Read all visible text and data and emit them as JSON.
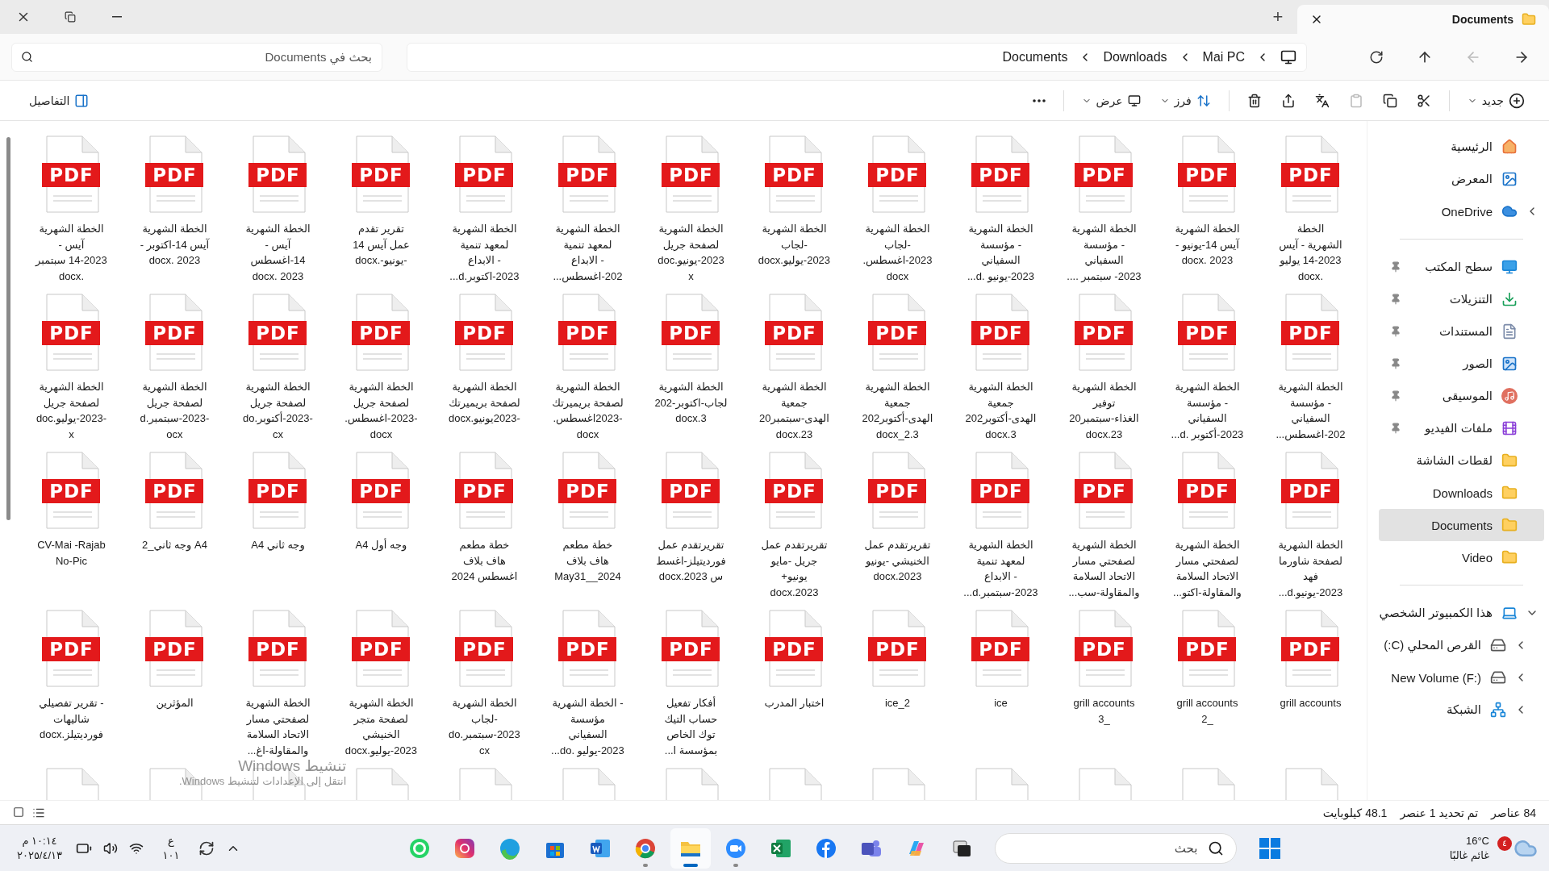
{
  "window": {
    "tab_title": "Documents",
    "new_tab": "+"
  },
  "search": {
    "placeholder": "بحث في Documents"
  },
  "breadcrumb": [
    "Mai PC",
    "Downloads",
    "Documents"
  ],
  "nav": [
    {
      "disabled": false
    },
    {
      "disabled": true
    },
    {
      "disabled": false
    },
    {
      "disabled": false
    }
  ],
  "toolbar": {
    "new_label": "جديد",
    "actions": [
      {
        "disabled": false
      },
      {
        "disabled": false
      },
      {
        "disabled": true
      },
      {
        "disabled": false
      },
      {
        "disabled": false
      },
      {
        "disabled": false
      }
    ],
    "sort_label": "فرز",
    "view_label": "عرض",
    "details_label": "التفاصيل"
  },
  "files": [
    {
      "label": "الخطة\nالشهرية - آيس\n14-2023 يوليو\n.docx",
      "badge": "PDF",
      "cut_off": false
    },
    {
      "label": "الخطة الشهرية\nآيس 14-يونيو -\n2023 .docx",
      "badge": "PDF",
      "cut_off": false
    },
    {
      "label": "الخطة الشهرية\n- مؤسسة\nالسفياني\n2023- سبتمبر ....",
      "badge": "PDF",
      "cut_off": false
    },
    {
      "label": "الخطة الشهرية\n- مؤسسة\nالسفياني\n2023-يونيو .d...",
      "badge": "PDF",
      "cut_off": false
    },
    {
      "label": "الخطة الشهرية\n-لجاب\n2023-اغسطس.\ndocx",
      "badge": "PDF",
      "cut_off": false
    },
    {
      "label": "الخطة الشهرية\n-لجاب\n2023-يوليو.docx",
      "badge": "PDF",
      "cut_off": false
    },
    {
      "label": "الخطة الشهرية\nلصفحة جريل\n2023-يونيو.doc\nx",
      "badge": "PDF",
      "cut_off": false
    },
    {
      "label": "الخطة الشهرية\nلمعهد تنمية\n- الابداع\n202-اغسطس...",
      "badge": "PDF",
      "cut_off": false
    },
    {
      "label": "الخطة الشهرية\nلمعهد تنمية\n- الابداع\n2023-اكتوبر.d...",
      "badge": "PDF",
      "cut_off": false
    },
    {
      "label": "تقرير تقدم\nعمل آيس 14\n-يونيو-.docx",
      "badge": "PDF",
      "cut_off": false
    },
    {
      "label": "الخطة الشهرية\nآيس -\n14-اغسطس\n2023 .docx",
      "badge": "PDF",
      "cut_off": false
    },
    {
      "label": "الخطة الشهرية\nآيس 14-اكتوبر -\n2023 .docx",
      "badge": "PDF",
      "cut_off": false
    },
    {
      "label": "الخطة الشهرية\nآيس -\n14-2023 سبتمبر\n.docx",
      "badge": "PDF",
      "cut_off": false
    },
    {
      "label": "الخطة الشهرية\n- مؤسسة\nالسفياني\n202-اغسطس...",
      "badge": "PDF",
      "cut_off": false
    },
    {
      "label": "الخطة الشهرية\n- مؤسسة\nالسفياني\n2023-أكتوبر .d...",
      "badge": "PDF",
      "cut_off": false
    },
    {
      "label": "الخطة الشهرية\nتوفير\nالغذاء-سبتمبر20\n23.docx",
      "badge": "PDF",
      "cut_off": false
    },
    {
      "label": "الخطة الشهرية\nجمعية\nالهدى-أكتوبر202\n3.docx",
      "badge": "PDF",
      "cut_off": false
    },
    {
      "label": "الخطة الشهرية\nجمعية\nالهدى-أكتوبر202\n3.docx_2",
      "badge": "PDF",
      "cut_off": false
    },
    {
      "label": "الخطة الشهرية\nجمعية\nالهدى-سبتمبر20\n23.docx",
      "badge": "PDF",
      "cut_off": false
    },
    {
      "label": "الخطة الشهرية\nلجاب-اكتوبر-202\n3.docx",
      "badge": "PDF",
      "cut_off": false
    },
    {
      "label": "الخطة الشهرية\nلصفحة بريميرتك\n-2023اغسطس.\ndocx",
      "badge": "PDF",
      "cut_off": false
    },
    {
      "label": "الخطة الشهرية\nلصفحة بريميرتك\n-2023يونيو.docx",
      "badge": "PDF",
      "cut_off": false
    },
    {
      "label": "الخطة الشهرية\nلصفحة جريل\n-2023-اغسطس.\ndocx",
      "badge": "PDF",
      "cut_off": false
    },
    {
      "label": "الخطة الشهرية\nلصفحة جريل\n-2023-أكتوبر.do\ncx",
      "badge": "PDF",
      "cut_off": false
    },
    {
      "label": "الخطة الشهرية\nلصفحة جريل\n-2023-سبتمبر.d\nocx",
      "badge": "PDF",
      "cut_off": false
    },
    {
      "label": "الخطة الشهرية\nلصفحة جريل\n-2023-يوليو.doc\nx",
      "badge": "PDF",
      "cut_off": false
    },
    {
      "label": "الخطة الشهرية\nلصفحة شاورما\nفهد\n2023-يونيو.d...",
      "badge": "PDF",
      "cut_off": false
    },
    {
      "label": "الخطة الشهرية\nلصفحتي مسار\nالاتحاد السلامة\nوالمقاولة-اكتو...",
      "badge": "PDF",
      "cut_off": false
    },
    {
      "label": "الخطة الشهرية\nلصفحتي مسار\nالاتحاد السلامة\nوالمقاولة-سب...",
      "badge": "PDF",
      "cut_off": false
    },
    {
      "label": "الخطة الشهرية\nلمعهد تنمية\n- الابداع\n2023-سبتمبر.d...",
      "badge": "PDF",
      "cut_off": false
    },
    {
      "label": "تقريرتقدم عمل\nالخنيشي -يونيو\n2023.docx",
      "badge": "PDF",
      "cut_off": false
    },
    {
      "label": "تقريرتقدم عمل\nجريل -مايو\nيونيو+\n2023.docx",
      "badge": "PDF",
      "cut_off": false
    },
    {
      "label": "تقريرتقدم عمل\nفورديتيلز-اغسط\nس 2023.docx",
      "badge": "PDF",
      "cut_off": false
    },
    {
      "label": "خطة مطعم\nهاف بلاف\nMay31__2024",
      "badge": "PDF",
      "cut_off": false
    },
    {
      "label": "خطة مطعم\nهاف بلاف\nاغسطس 2024",
      "badge": "PDF",
      "cut_off": false
    },
    {
      "label": "وجه أول A4",
      "badge": "PDF",
      "cut_off": false
    },
    {
      "label": "وجه ثاني A4",
      "badge": "PDF",
      "cut_off": false
    },
    {
      "label": "A4 وجه ثاني_2",
      "badge": "PDF",
      "cut_off": false
    },
    {
      "label": "CV-Mai -Rajab\nNo-Pic",
      "badge": "PDF",
      "cut_off": false
    },
    {
      "label": "grill accounts",
      "badge": "PDF",
      "cut_off": false
    },
    {
      "label": "grill accounts\n_2",
      "badge": "PDF",
      "cut_off": false
    },
    {
      "label": "grill accounts\n_3",
      "badge": "PDF",
      "cut_off": false
    },
    {
      "label": "ice",
      "badge": "PDF",
      "cut_off": false
    },
    {
      "label": "ice_2",
      "badge": "PDF",
      "cut_off": false
    },
    {
      "label": "اختبار المدرب",
      "badge": "PDF",
      "cut_off": false
    },
    {
      "label": "أفكار تفعيل\nحساب التيك\nتوك الخاص\nبمؤسسة ا...",
      "badge": "PDF",
      "cut_off": false
    },
    {
      "label": "- الخطة الشهرية\nمؤسسة\nالسفياني\n2023-يوليو .do...",
      "badge": "PDF",
      "cut_off": false
    },
    {
      "label": "الخطة الشهرية\n-لجاب\n2023-سبتمبر.do\ncx",
      "badge": "PDF",
      "cut_off": false
    },
    {
      "label": "الخطة الشهرية\nلصفحة متجر\nالخنيشي\n2023-يوليو.docx",
      "badge": "PDF",
      "cut_off": false
    },
    {
      "label": "الخطة الشهرية\nلصفحتي مسار\nالاتحاد السلامة\nوالمقاولة-اغ...",
      "badge": "PDF",
      "cut_off": false
    },
    {
      "label": "المؤثرين",
      "badge": "PDF",
      "cut_off": false
    },
    {
      "label": "- تقرير تفصيلي\nشاليهات\nفورديتيلز.docx",
      "badge": "PDF",
      "cut_off": false
    },
    {
      "cut_off": true
    },
    {
      "cut_off": true
    },
    {
      "cut_off": true
    },
    {
      "cut_off": true
    },
    {
      "cut_off": true
    },
    {
      "cut_off": true
    },
    {
      "cut_off": true
    },
    {
      "cut_off": true
    },
    {
      "cut_off": true
    },
    {
      "cut_off": true
    },
    {
      "cut_off": true
    },
    {
      "cut_off": true
    },
    {
      "cut_off": true
    }
  ],
  "activation": {
    "title": "تنشيط Windows",
    "hint": "انتقل إلى الإعدادات لتنشيط Windows."
  },
  "sidebar": {
    "groups": [
      [
        {
          "label": "الرئيسية",
          "pinned": false,
          "expandable": false,
          "expanded": false,
          "selected": false
        },
        {
          "label": "المعرض",
          "pinned": false,
          "expandable": false,
          "expanded": false,
          "selected": false
        },
        {
          "label": "OneDrive",
          "pinned": false,
          "expandable": true,
          "expanded": false,
          "selected": false
        }
      ],
      [
        {
          "label": "سطح المكتب",
          "pinned": true,
          "expandable": false,
          "expanded": false,
          "selected": false
        },
        {
          "label": "التنزيلات",
          "pinned": true,
          "expandable": false,
          "expanded": false,
          "selected": false
        },
        {
          "label": "المستندات",
          "pinned": true,
          "expandable": false,
          "expanded": false,
          "selected": false
        },
        {
          "label": "الصور",
          "pinned": true,
          "expandable": false,
          "expanded": false,
          "selected": false
        },
        {
          "label": "الموسيقى",
          "pinned": true,
          "expandable": false,
          "expanded": false,
          "selected": false
        },
        {
          "label": "ملفات الفيديو",
          "pinned": true,
          "expandable": false,
          "expanded": false,
          "selected": false
        },
        {
          "label": "لقطات الشاشة",
          "pinned": false,
          "expandable": false,
          "expanded": false,
          "selected": false
        },
        {
          "label": "Downloads",
          "pinned": false,
          "expandable": false,
          "expanded": false,
          "selected": false
        },
        {
          "label": "Documents",
          "pinned": false,
          "expandable": false,
          "expanded": false,
          "selected": true
        },
        {
          "label": "Video",
          "pinned": false,
          "expandable": false,
          "expanded": false,
          "selected": false
        }
      ],
      [
        {
          "label": "هذا الكمبيوتر الشخصي",
          "pinned": false,
          "expandable": true,
          "expanded": true,
          "selected": false
        },
        {
          "label": "القرص المحلي (C:)",
          "pinned": false,
          "expandable": true,
          "expanded": false,
          "selected": false
        },
        {
          "label": "New Volume (F:)",
          "pinned": false,
          "expandable": true,
          "expanded": false,
          "selected": false
        },
        {
          "label": "الشبكة",
          "pinned": false,
          "expandable": true,
          "expanded": false,
          "selected": false
        }
      ]
    ]
  },
  "status_bar": {
    "count": "84 عناصر",
    "selection": "تم تحديد 1 عنصر",
    "size": "48.1 كيلوبايت"
  },
  "taskbar": {
    "weather": {
      "temp": "16°C",
      "desc": "غائم غالبًا",
      "badge": "٤"
    },
    "search_placeholder": "بحث",
    "apps": [
      {
        "running": false,
        "active": false
      },
      {
        "running": false,
        "active": false
      },
      {
        "running": false,
        "active": false
      },
      {
        "running": false,
        "active": false
      },
      {
        "running": false,
        "active": false
      },
      {
        "running": true,
        "active": false
      },
      {
        "running": true,
        "active": true
      },
      {
        "running": true,
        "active": false
      },
      {
        "running": false,
        "active": false
      },
      {
        "running": false,
        "active": false
      },
      {
        "running": false,
        "active": false
      },
      {
        "running": false,
        "active": false
      },
      {
        "running": false,
        "active": false
      },
      {
        "running": false,
        "active": false
      }
    ],
    "lang": "ع",
    "lang_code": "١٠١",
    "time": "١٠:١٤ م",
    "date": "٢٠٢٥/٤/١٣"
  }
}
